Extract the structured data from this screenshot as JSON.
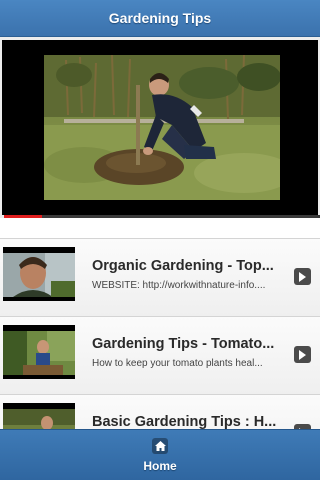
{
  "header": {
    "title": "Gardening Tips"
  },
  "player": {
    "progress": 0.12
  },
  "videos": [
    {
      "title": "Organic Gardening - Top...",
      "description": "WEBSITE: http://workwithnature-info...."
    },
    {
      "title": "Gardening Tips - Tomato...",
      "description": "How to keep your tomato plants heal..."
    },
    {
      "title": "Basic Gardening Tips : H...",
      "description": ""
    }
  ],
  "footer": {
    "home_label": "Home"
  },
  "colors": {
    "header": "#3f78b3",
    "footer": "#3572ad",
    "progress": "#e01e1e",
    "arrow_button": "#4b4b4b"
  },
  "icons": {
    "arrow": "chevron-right-icon",
    "home": "home-icon"
  }
}
